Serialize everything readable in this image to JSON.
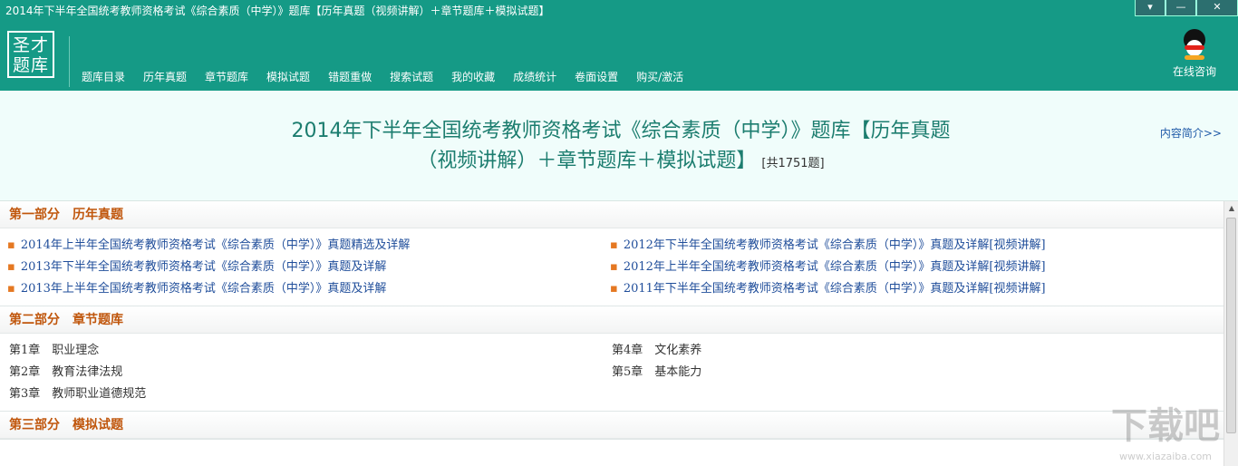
{
  "window": {
    "title": "2014年下半年全国统考教师资格考试《综合素质（中学）》题库【历年真题（视频讲解）＋章节题库＋模拟试题】",
    "btn_menu": "▾",
    "btn_minimize": "—",
    "btn_close": "✕"
  },
  "logo": {
    "line1": "圣才",
    "line2": "题库"
  },
  "nav": {
    "items": [
      "题库目录",
      "历年真题",
      "章节题库",
      "模拟试题",
      "错题重做",
      "搜索试题",
      "我的收藏",
      "成绩统计",
      "卷面设置",
      "购买/激活"
    ],
    "consult_label": "在线咨询"
  },
  "header": {
    "title_line1": "2014年下半年全国统考教师资格考试《综合素质（中学）》题库【历年真题",
    "title_line2": "（视频讲解）＋章节题库＋模拟试题】",
    "count": "[共1751题]",
    "intro_link": "内容简介>>"
  },
  "sections": [
    {
      "title": "第一部分　历年真题",
      "left": [
        "2014年上半年全国统考教师资格考试《综合素质（中学）》真题精选及详解",
        "2013年下半年全国统考教师资格考试《综合素质（中学）》真题及详解",
        "2013年上半年全国统考教师资格考试《综合素质（中学）》真题及详解"
      ],
      "right": [
        "2012年下半年全国统考教师资格考试《综合素质（中学）》真题及详解[视频讲解]",
        "2012年上半年全国统考教师资格考试《综合素质（中学）》真题及详解[视频讲解]",
        "2011年下半年全国统考教师资格考试《综合素质（中学）》真题及详解[视频讲解]"
      ]
    },
    {
      "title": "第二部分　章节题库",
      "left": [
        "第1章　职业理念",
        "第2章　教育法律法规",
        "第3章　教师职业道德规范"
      ],
      "right": [
        "第4章　文化素养",
        "第5章　基本能力"
      ]
    },
    {
      "title": "第三部分　模拟试题"
    }
  ],
  "watermark": {
    "main": "下载吧",
    "sub": "www.xiazaiba.com"
  },
  "colors": {
    "bar": "#159a86",
    "accent": "#c0560c",
    "link": "#1f4d9a",
    "bullet": "#e57822"
  }
}
